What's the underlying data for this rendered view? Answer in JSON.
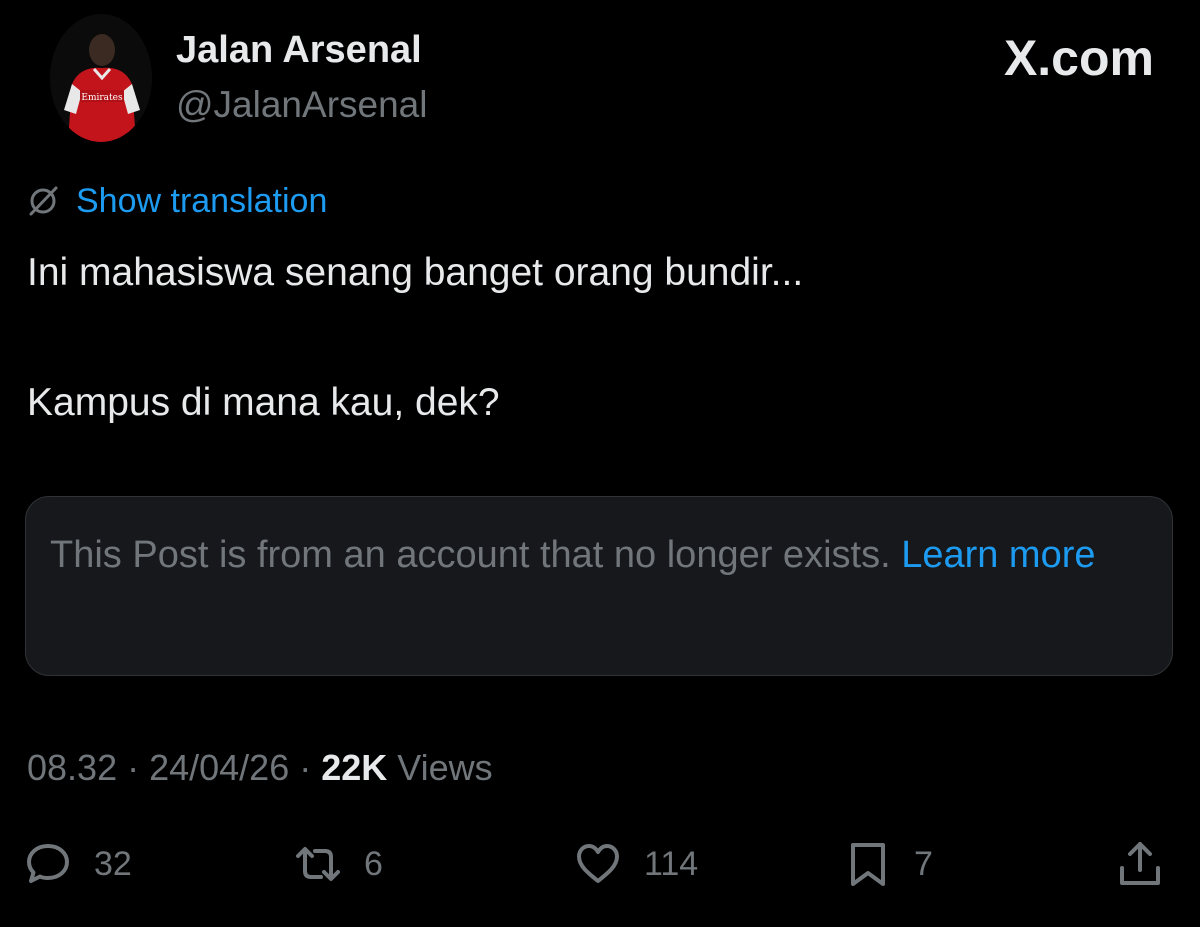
{
  "author": {
    "display_name": "Jalan Arsenal",
    "handle": "@JalanArsenal",
    "avatar_shirt_text": "Emirates"
  },
  "watermark": "X.com",
  "translation": {
    "icon": "globe-slash-icon",
    "label": "Show translation"
  },
  "post": {
    "lines": [
      "Ini mahasiswa senang banget orang bundir...",
      "Kampus di mana kau, dek?"
    ]
  },
  "notice": {
    "text": "This Post is from an account that no longer exists. ",
    "link": "Learn more"
  },
  "meta": {
    "time": "08.32",
    "separator": " · ",
    "date": "24/04/26",
    "views_count": "22K",
    "views_label": " Views"
  },
  "actions": {
    "reply": {
      "icon": "reply-icon",
      "count": "32"
    },
    "repost": {
      "icon": "repost-icon",
      "count": "6"
    },
    "like": {
      "icon": "heart-icon",
      "count": "114"
    },
    "bookmark": {
      "icon": "bookmark-icon",
      "count": "7"
    },
    "share": {
      "icon": "share-icon"
    }
  },
  "colors": {
    "background": "#000000",
    "text_primary": "#e7e9ea",
    "text_secondary": "#71767b",
    "accent": "#1d9bf0",
    "card_background": "#16181c"
  }
}
